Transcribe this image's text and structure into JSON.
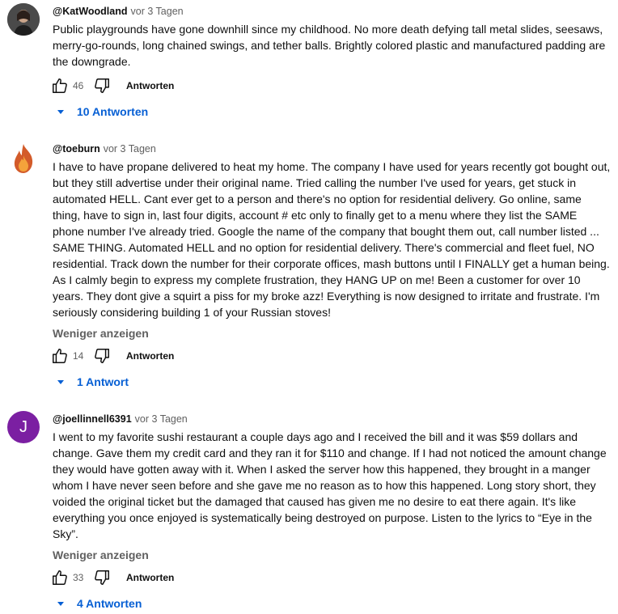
{
  "comments": [
    {
      "handle": "@KatWoodland",
      "time": "vor 3 Tagen",
      "text": "Public playgrounds have gone downhill since my childhood. No more death defying tall metal slides, seesaws, merry-go-rounds, long chained swings, and tether balls. Brightly colored plastic and manufactured padding are the downgrade.",
      "likes": "46",
      "reply_label": "Antworten",
      "replies_label": "10 Antworten"
    },
    {
      "handle": "@toeburn",
      "time": "vor 3 Tagen",
      "text": "I have to have propane delivered to heat my home. The company I have used for years recently got bought out, but they still advertise under their original name. Tried calling the number I've used for years, get stuck in automated HELL. Cant ever get to a person and there's no option for residential delivery. Go online, same thing, have to sign in, last four digits, account # etc only to finally get to a menu where they list the SAME phone number I've already tried. Google the name of the company that bought them out, call number listed ... SAME THING. Automated HELL and no option for residential delivery. There's commercial and fleet fuel, NO residential. Track down the number for their corporate offices, mash buttons until I FINALLY get a human being. As I calmly begin to express my complete frustration, they HANG UP on me! Been a customer for over 10 years. They dont give a squirt a piss for my broke azz! Everything is now designed to irritate and frustrate.  I'm seriously considering building 1 of your Russian stoves!",
      "show_less": "Weniger anzeigen",
      "likes": "14",
      "reply_label": "Antworten",
      "replies_label": "1 Antwort"
    },
    {
      "handle": "@joellinnell6391",
      "time": "vor 3 Tagen",
      "avatar_letter": "J",
      "text": "I went to my favorite sushi restaurant a couple days ago and I received the bill and it was $59 dollars and change. Gave them my credit card and they ran it for $110 and change.  If I had not noticed the amount change they would have gotten away with it.  When I asked the server how this happened, they brought in a manger whom I have never seen before and she gave me no reason as to how this happened.  Long story short, they voided the original ticket but the damaged that caused has given me no desire to eat there again.  It's like everything you once enjoyed is systematically being destroyed on purpose.  Listen to the lyrics to “Eye in the Sky”.",
      "show_less": "Weniger anzeigen",
      "likes": "33",
      "reply_label": "Antworten",
      "replies_label": "4 Antworten"
    }
  ],
  "colors": {
    "link": "#065fd4",
    "avatar_j": "#7b1fa2",
    "muted": "#606060"
  },
  "icons": [
    "thumbs-up-icon",
    "thumbs-down-icon",
    "chevron-down-icon"
  ]
}
